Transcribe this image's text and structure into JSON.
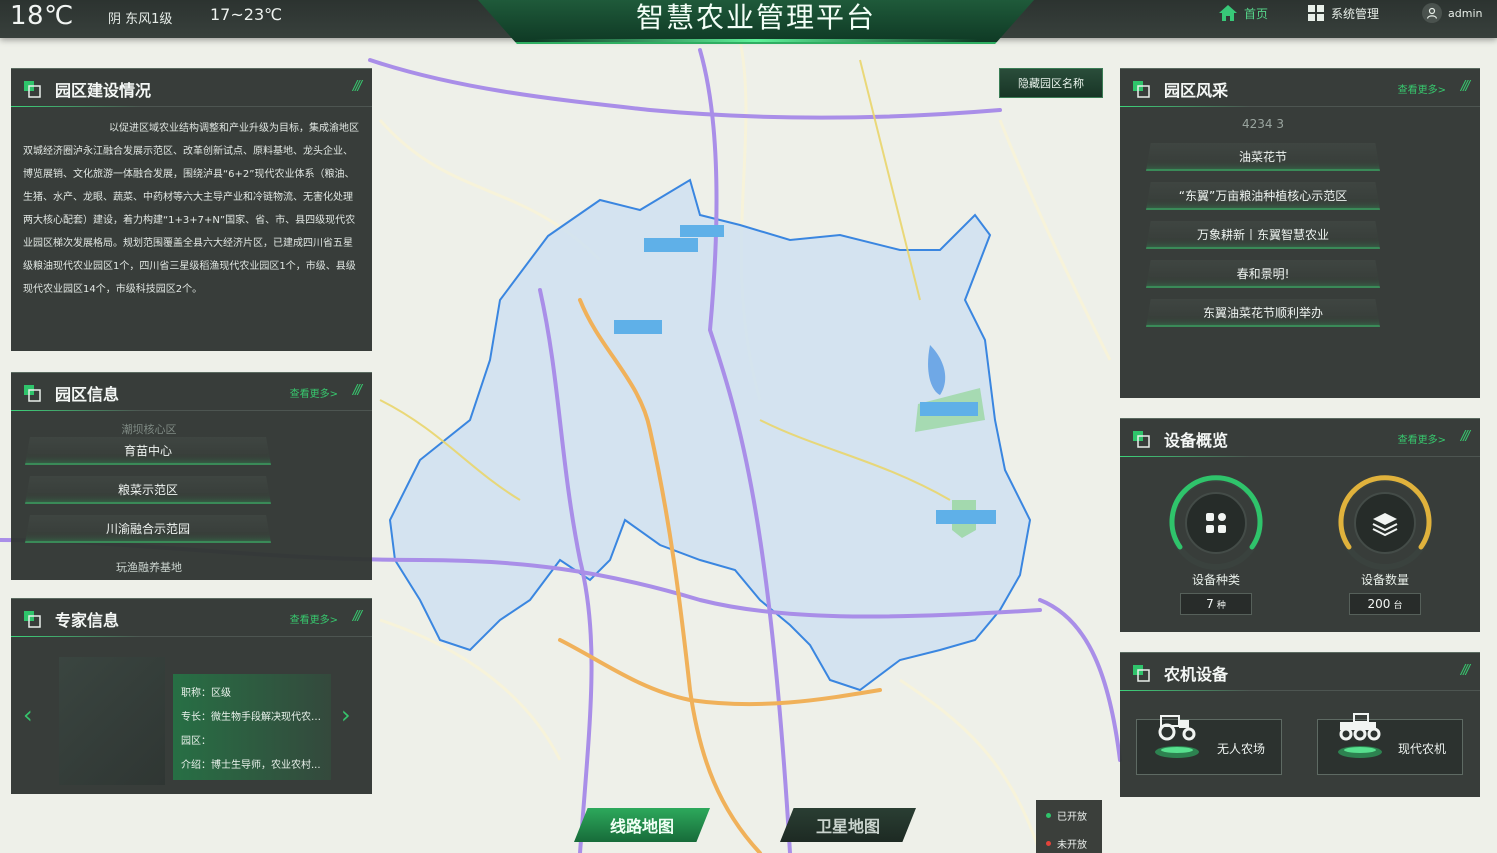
{
  "header": {
    "temperature": "18℃",
    "weather": "阴 东风1级",
    "temp_range": "17~23℃",
    "title": "智慧农业管理平台",
    "nav_home": "首页",
    "nav_system": "系统管理",
    "nav_user": "admin"
  },
  "map": {
    "hide_button": "隐藏园区名称",
    "btn_route": "线路地图",
    "btn_satellite": "卫星地图",
    "legend_open": "已开放",
    "legend_closed": "未开放",
    "legend_open_color": "#2fc46b",
    "legend_closed_color": "#e3433a"
  },
  "park_construction": {
    "title": "园区建设情况",
    "slashes": "///",
    "text": "以促进区域农业结构调整和产业升级为目标，集成渝地区双城经济圈泸永江融合发展示范区、改革创新试点、原料基地、龙头企业、博览展销、文化旅游一体融合发展，围绕泸县“6+2”现代农业体系（粮油、生猪、水产、龙眼、蔬菜、中药材等六大主导产业和冷链物流、无害化处理两大核心配套）建设，着力构建“1+3+7+N”国家、省、市、县四级现代农业园区梯次发展格局。规划范围覆盖全县六大经济片区，已建成四川省五星级粮油现代农业园区1个，四川省三星级稻渔现代农业园区1个，市级、县级现代农业园区14个，市级科技园区2个。"
  },
  "park_info": {
    "title": "园区信息",
    "more": "查看更多>",
    "slashes": "///",
    "faded_top": "潮坝核心区",
    "items": [
      "育苗中心",
      "粮菜示范区",
      "川渝融合示范园"
    ],
    "faded_bottom": "玩渔融养基地"
  },
  "expert_info": {
    "title": "专家信息",
    "more": "查看更多>",
    "slashes": "///",
    "rows": [
      "职称：区级",
      "专长：微生物手段解决现代农业...",
      "园区：",
      "介绍：博士生导师，农业农村..."
    ]
  },
  "park_style": {
    "title": "园区风采",
    "more": "查看更多>",
    "slashes": "///",
    "faded_top": "4234 3",
    "items": [
      "油菜花节",
      "“东翼”万亩粮油种植核心示范区",
      "万象耕新丨东翼智慧农业",
      "春和景明!",
      "东翼油菜花节顺利举办"
    ]
  },
  "device_overview": {
    "title": "设备概览",
    "more": "查看更多>",
    "slashes": "///",
    "type_label": "设备种类",
    "type_value": "7",
    "type_unit": "种",
    "count_label": "设备数量",
    "count_value": "200",
    "count_unit": "台",
    "type_color": "#2fc46b",
    "count_color": "#e0b23c"
  },
  "farm_machines": {
    "title": "农机设备",
    "slashes": "///",
    "item1": "无人农场",
    "item2": "现代农机"
  }
}
